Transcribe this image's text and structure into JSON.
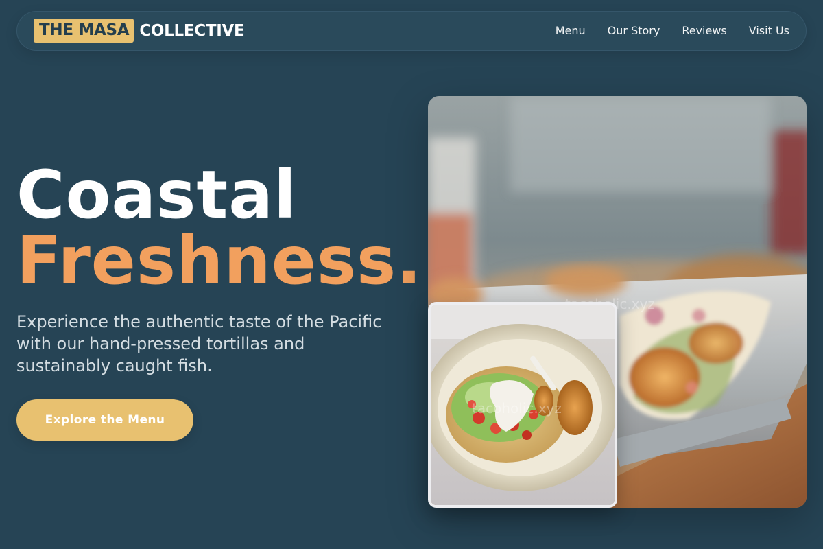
{
  "brand": {
    "mark": "THE MASA",
    "name": "COLLECTIVE"
  },
  "nav": {
    "items": [
      {
        "label": "Menu"
      },
      {
        "label": "Our Story"
      },
      {
        "label": "Reviews"
      },
      {
        "label": "Visit Us"
      }
    ]
  },
  "hero": {
    "title_line1": "Coastal",
    "title_line2": "Freshness.",
    "subtitle": "Experience the authentic taste of the Pacific with our hand-pressed tortillas and sustainably caught fish.",
    "cta_label": "Explore the Menu"
  },
  "images": {
    "main_watermark": "tacoholic.xyz",
    "inset_watermark": "tacoholic.xyz"
  },
  "colors": {
    "background": "#264455",
    "accent_gold": "#e8c170",
    "accent_orange": "#f2a05e"
  }
}
